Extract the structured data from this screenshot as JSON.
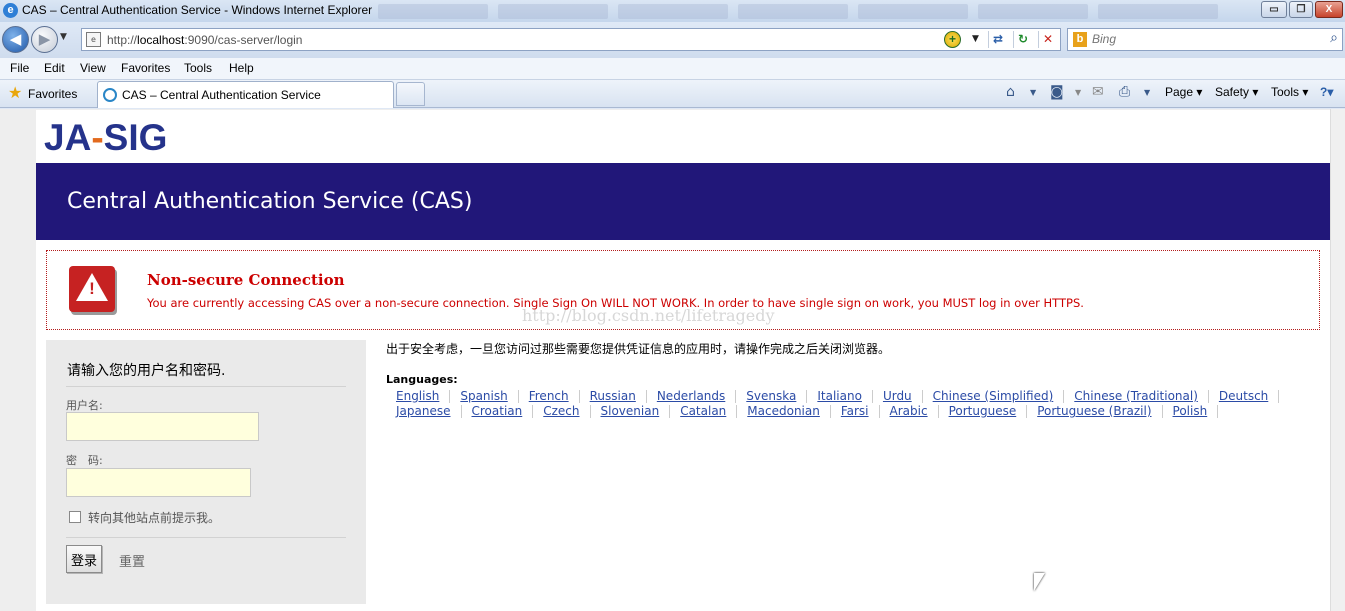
{
  "window": {
    "title": "CAS – Central Authentication Service - Windows Internet Explorer",
    "ie_icon": "e",
    "minimize_glyph": "▭",
    "maximize_glyph": "❐",
    "close_glyph": "X"
  },
  "nav": {
    "back_glyph": "◀",
    "forward_glyph": "▶",
    "dropdown_glyph": "▼",
    "address_prefix": "http://",
    "address_host": "localhost",
    "address_rest": ":9090/cas-server/login",
    "page_icon": "e",
    "compat_glyph": "+",
    "refresh_glyph": "↻",
    "stop_glyph": "✕",
    "feed_glyph": "⇄",
    "search_placeholder": "Bing",
    "bing_glyph": "b",
    "search_glyph": "⌕"
  },
  "menu": [
    "File",
    "Edit",
    "View",
    "Favorites",
    "Tools",
    "Help"
  ],
  "favbar": {
    "favorites_label": "Favorites",
    "star_glyph": "★",
    "tab_title": "CAS – Central Authentication Service",
    "home_glyph": "⌂",
    "feeds_glyph": "◙",
    "mail_glyph": "✉",
    "print_glyph": "⎙",
    "page_label": "Page ▾",
    "safety_label": "Safety ▾",
    "tools_label": "Tools ▾",
    "help_glyph": "?▾"
  },
  "page": {
    "logo_left": "JA",
    "logo_dash": "-",
    "logo_right": "SIG",
    "banner_title": "Central Authentication Service (CAS)",
    "warning_title": "Non-secure Connection",
    "warning_text": "You are currently accessing CAS over a non-secure connection. Single Sign On WILL NOT WORK. In order to have single sign on work, you MUST log in over HTTPS.",
    "warning_icon_glyph": "!",
    "watermark": "http://blog.csdn.net/lifetragedy",
    "login_heading": "请输入您的用户名和密码.",
    "username_label": "用户名:",
    "password_label": "密　码:",
    "warn_label": "转向其他站点前提示我。",
    "login_button": "登录",
    "reset_button": "重置",
    "security_note": "出于安全考虑，一旦您访问过那些需要您提供凭证信息的应用时，请操作完成之后关闭浏览器。",
    "languages_label": "Languages:",
    "languages_row1": [
      "English",
      "Spanish",
      "French",
      "Russian",
      "Nederlands",
      "Svenska",
      "Italiano",
      "Urdu",
      "Chinese (Simplified)",
      "Chinese (Traditional)",
      "Deutsch"
    ],
    "languages_row2": [
      "Japanese",
      "Croatian",
      "Czech",
      "Slovenian",
      "Catalan",
      "Macedonian",
      "Farsi",
      "Arabic",
      "Portuguese",
      "Portuguese (Brazil)",
      "Polish"
    ]
  }
}
